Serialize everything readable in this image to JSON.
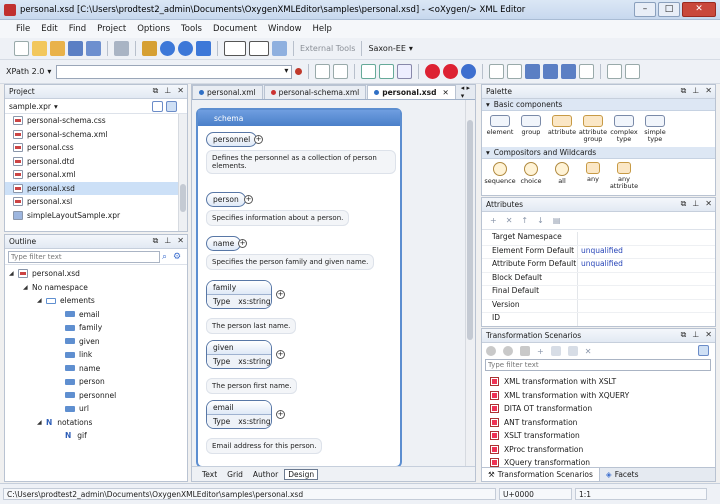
{
  "window": {
    "title": "personal.xsd [C:\\Users\\prodtest2_admin\\Documents\\OxygenXMLEditor\\samples\\personal.xsd] - <oXygen/> XML Editor",
    "controls": [
      "–",
      "□",
      "✕"
    ]
  },
  "menu": [
    "File",
    "Edit",
    "Find",
    "Project",
    "Options",
    "Tools",
    "Document",
    "Window",
    "Help"
  ],
  "toolbar": {
    "external_tools": "External Tools",
    "transformer": "Saxon-EE",
    "xpath_label": "XPath 2.0",
    "xpath_value": "",
    "icons": [
      "new-file-icon",
      "open-file-icon",
      "open-url-icon",
      "save-icon",
      "save-all-icon",
      "print-icon",
      "find-icon",
      "back-icon",
      "forward-icon",
      "up-icon",
      "xslt-debugger-icon",
      "xquery-debugger-icon",
      "tree-editor-icon",
      "validate-icon",
      "check-wellformed-icon",
      "apply-scenario-icon",
      "configure-scenario-icon",
      "run-icon"
    ]
  },
  "project": {
    "title": "Project",
    "selector": "sample.xpr",
    "files": [
      "personal-schema.css",
      "personal-schema.xml",
      "personal.css",
      "personal.dtd",
      "personal.xml",
      "personal.xsd",
      "personal.xsl",
      "simpleLayoutSample.xpr"
    ],
    "selected_index": 5
  },
  "outline": {
    "title": "Outline",
    "filter_placeholder": "Type filter text",
    "root": "personal.xsd",
    "namespace": "No namespace",
    "elements_label": "elements",
    "elements": [
      "email",
      "family",
      "given",
      "link",
      "name",
      "person",
      "personnel",
      "url"
    ],
    "notations_label": "notations",
    "notations": [
      "gif"
    ]
  },
  "editor": {
    "tabs": [
      {
        "label": "personal.xml",
        "active": false,
        "modified": false
      },
      {
        "label": "personal-schema.xml",
        "active": false,
        "modified": true
      },
      {
        "label": "personal.xsd",
        "active": true,
        "modified": false
      }
    ],
    "schema_header": "schema",
    "nodes": [
      {
        "name": "personnel",
        "doc": "Defines the personnel as a collection of person elements."
      },
      {
        "name": "person",
        "doc": "Specifies information about a person."
      },
      {
        "name": "name",
        "doc": "Specifies the person family and given name."
      }
    ],
    "complex_nodes": [
      {
        "name": "family",
        "type_label": "Type",
        "type": "xs:string",
        "doc": "The person last name."
      },
      {
        "name": "given",
        "type_label": "Type",
        "type": "xs:string",
        "doc": "The person first name."
      },
      {
        "name": "email",
        "type_label": "Type",
        "type": "xs:string",
        "doc": "Email address for this person."
      }
    ],
    "bottom_tabs": [
      "Text",
      "Grid",
      "Author",
      "Design"
    ],
    "active_bottom_tab": "Design"
  },
  "palette": {
    "title": "Palette",
    "sections": [
      {
        "label": "Basic components",
        "items": [
          "element",
          "group",
          "attribute",
          "attribute group",
          "complex type",
          "simple type"
        ]
      },
      {
        "label": "Compositors and Wildcards",
        "items": [
          "sequence",
          "choice",
          "all",
          "any",
          "any attribute"
        ]
      }
    ]
  },
  "attributes": {
    "title": "Attributes",
    "rows": [
      {
        "key": "Target Namespace",
        "value": ""
      },
      {
        "key": "Element Form Default",
        "value": "unqualified"
      },
      {
        "key": "Attribute Form Default",
        "value": "unqualified"
      },
      {
        "key": "Block Default",
        "value": ""
      },
      {
        "key": "Final Default",
        "value": ""
      },
      {
        "key": "Version",
        "value": ""
      },
      {
        "key": "ID",
        "value": ""
      }
    ]
  },
  "scenarios": {
    "title": "Transformation Scenarios",
    "filter_placeholder": "Type filter text",
    "items": [
      "XML transformation with XSLT",
      "XML transformation with XQUERY",
      "DITA OT transformation",
      "ANT transformation",
      "XSLT transformation",
      "XProc transformation",
      "XQuery transformation"
    ],
    "tabs": [
      "Transformation Scenarios",
      "Facets"
    ]
  },
  "status": {
    "path": "C:\\Users\\prodtest2_admin\\Documents\\OxygenXMLEditor\\samples\\personal.xsd",
    "unicode": "U+0000",
    "position": "1:1"
  }
}
